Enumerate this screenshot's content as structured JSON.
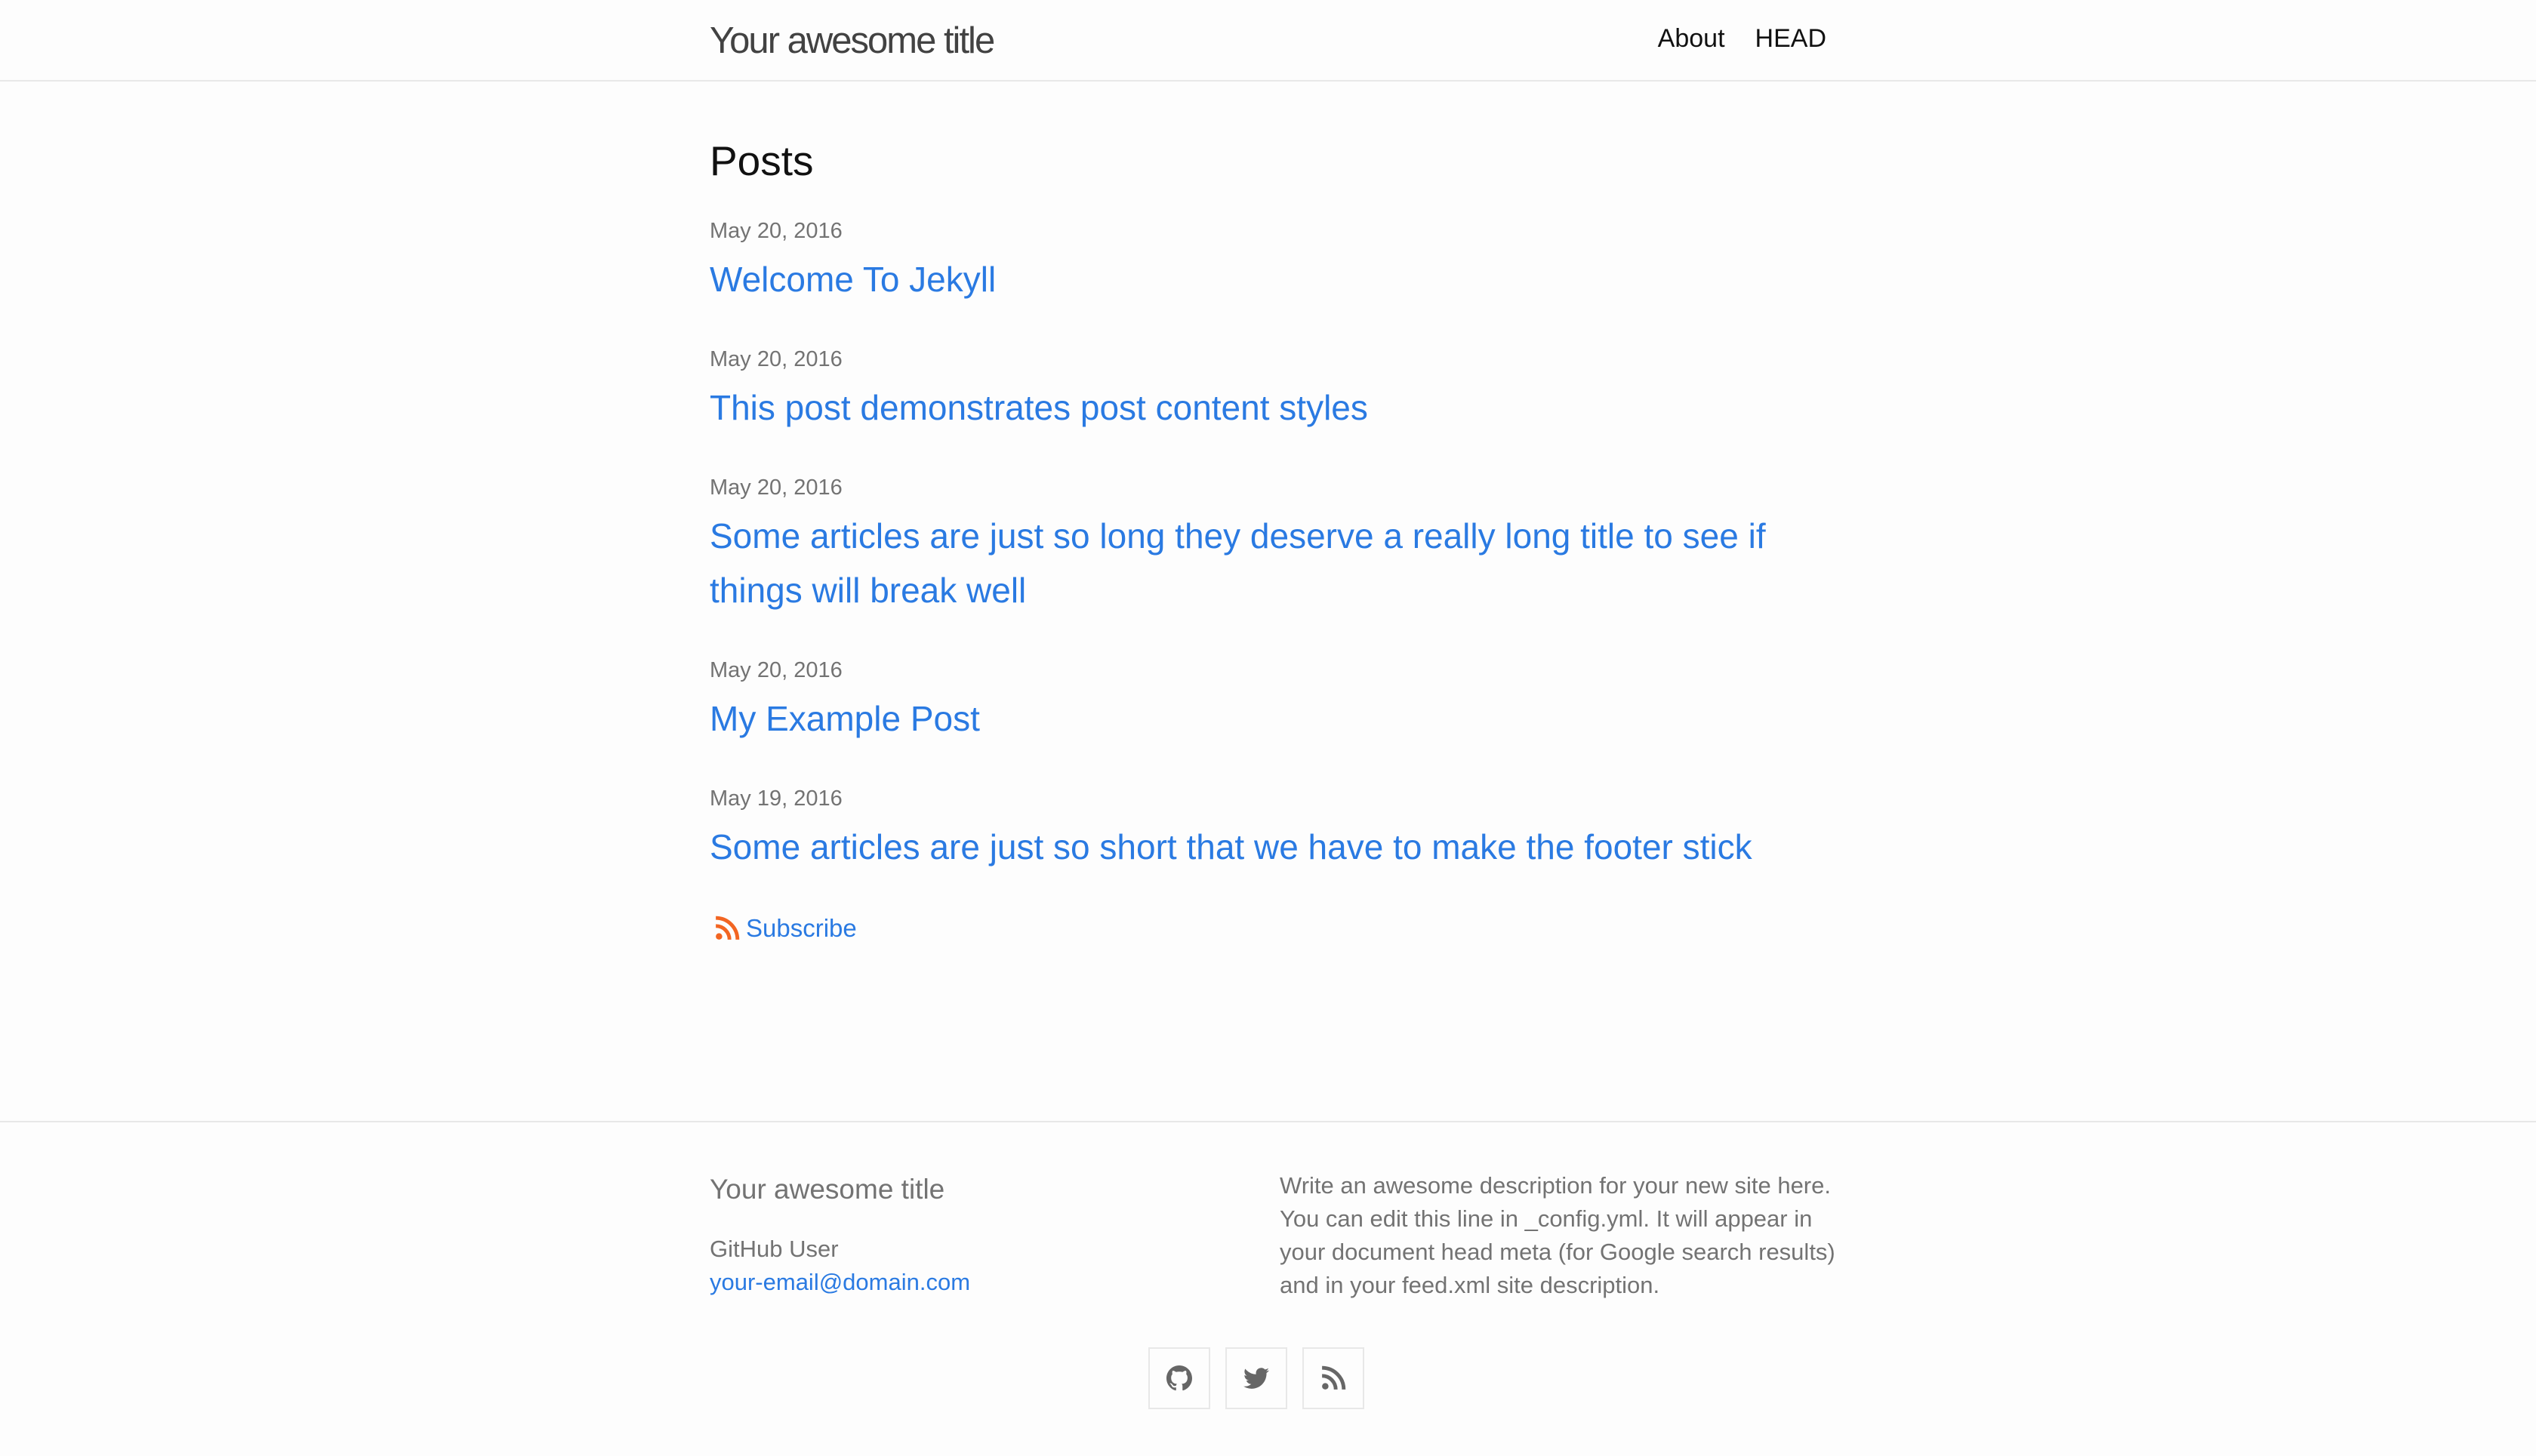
{
  "header": {
    "site_title": "Your awesome title",
    "nav": [
      {
        "label": "About"
      },
      {
        "label": "HEAD"
      }
    ]
  },
  "main": {
    "heading": "Posts",
    "posts": [
      {
        "date": "May 20, 2016",
        "title": "Welcome To Jekyll"
      },
      {
        "date": "May 20, 2016",
        "title": "This post demonstrates post content styles"
      },
      {
        "date": "May 20, 2016",
        "title": "Some articles are just so long they deserve a really long title to see if things will break well"
      },
      {
        "date": "May 20, 2016",
        "title": "My Example Post"
      },
      {
        "date": "May 19, 2016",
        "title": "Some articles are just so short that we have to make the footer stick"
      }
    ],
    "subscribe_label": "Subscribe"
  },
  "footer": {
    "heading": "Your awesome title",
    "author": "GitHub User",
    "email": "your-email@domain.com",
    "description": "Write an awesome description for your new site here. You can edit this line in _config.yml. It will appear in your document head meta (for Google search results) and in your feed.xml site description.",
    "social": [
      {
        "icon": "github-icon"
      },
      {
        "icon": "twitter-icon"
      },
      {
        "icon": "rss-icon"
      }
    ]
  },
  "colors": {
    "link": "#2a7ae2",
    "rss_orange": "#f26522",
    "muted_text": "#737373",
    "border": "#e8e8e8",
    "background": "#fdfdfd"
  }
}
